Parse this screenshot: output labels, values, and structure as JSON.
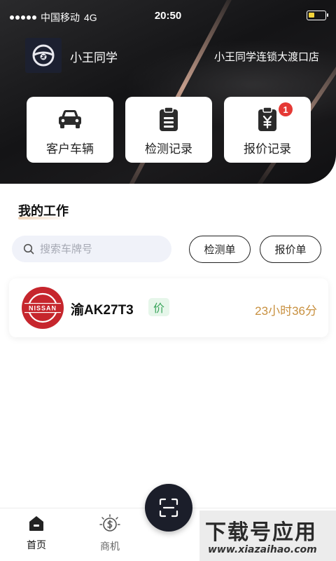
{
  "status_bar": {
    "carrier": "中国移动",
    "network": "4G",
    "time": "20:50"
  },
  "header": {
    "user_name": "小王同学",
    "store_name": "小王同学连锁大渡口店"
  },
  "quick_actions": [
    {
      "label": "客户车辆",
      "icon": "car-icon"
    },
    {
      "label": "检测记录",
      "icon": "clipboard-list-icon"
    },
    {
      "label": "报价记录",
      "icon": "clipboard-yuan-icon",
      "badge": "1"
    }
  ],
  "work": {
    "title": "我的工作",
    "search_placeholder": "搜索车牌号",
    "filter_buttons": [
      "检测单",
      "报价单"
    ],
    "items": [
      {
        "brand_text": "NISSAN",
        "plate": "渝AK27T3",
        "type_tag": "价",
        "duration": "23小时36分"
      }
    ]
  },
  "tabbar": {
    "tabs": [
      {
        "label": "首页",
        "icon": "home-icon",
        "active": true
      },
      {
        "label": "商机",
        "icon": "dollar-lightbulb-icon",
        "active": false
      }
    ],
    "center_icon": "scan-icon"
  },
  "watermark": {
    "main": "下载号应用",
    "sub": "www.xiazaihao.com"
  },
  "colors": {
    "accent_badge": "#e53935",
    "duration_text": "#c8903f",
    "tag_green": "#3aa55c",
    "brand_red": "#c6262d"
  }
}
